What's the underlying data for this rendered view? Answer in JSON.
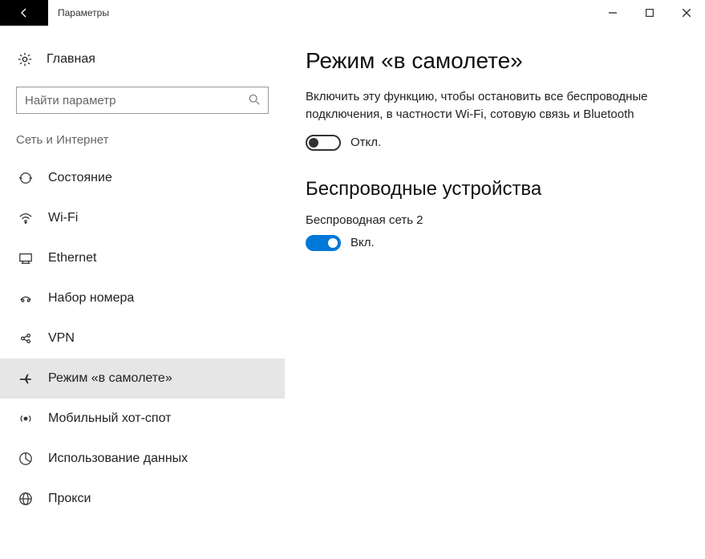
{
  "titlebar": {
    "title": "Параметры"
  },
  "sidebar": {
    "home": "Главная",
    "search_placeholder": "Найти параметр",
    "group": "Сеть и Интернет",
    "items": [
      {
        "label": "Состояние",
        "icon": "status"
      },
      {
        "label": "Wi-Fi",
        "icon": "wifi"
      },
      {
        "label": "Ethernet",
        "icon": "ethernet"
      },
      {
        "label": "Набор номера",
        "icon": "dialup"
      },
      {
        "label": "VPN",
        "icon": "vpn"
      },
      {
        "label": "Режим «в самолете»",
        "icon": "airplane",
        "selected": true
      },
      {
        "label": "Мобильный хот-спот",
        "icon": "hotspot"
      },
      {
        "label": "Использование данных",
        "icon": "datausage"
      },
      {
        "label": "Прокси",
        "icon": "proxy"
      }
    ]
  },
  "main": {
    "heading": "Режим «в самолете»",
    "description": "Включить эту функцию, чтобы остановить все беспроводные подключения, в частности Wi-Fi, сотовую связь и Bluetooth",
    "airplane_toggle_state": "off",
    "airplane_toggle_label": "Откл.",
    "wireless_heading": "Беспроводные устройства",
    "wireless_name": "Беспроводная сеть 2",
    "wireless_toggle_state": "on",
    "wireless_toggle_label": "Вкл."
  }
}
